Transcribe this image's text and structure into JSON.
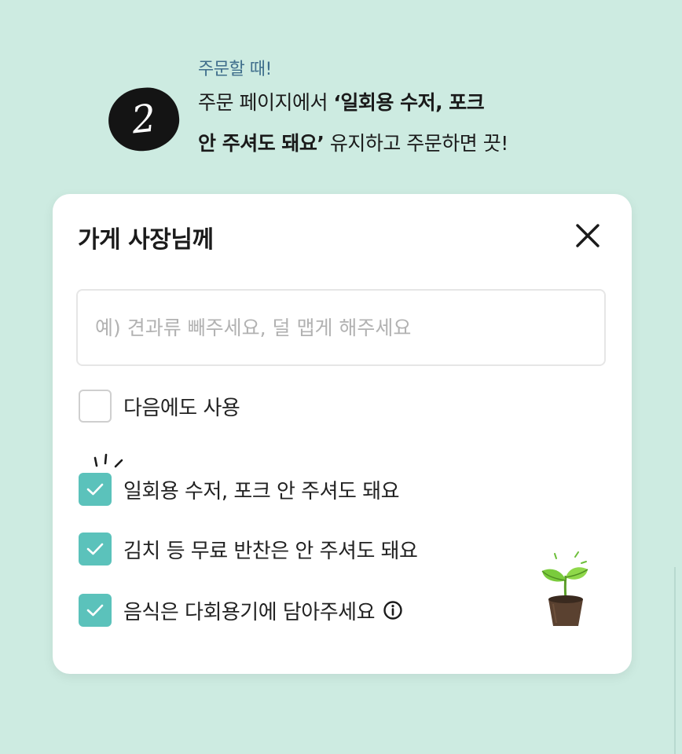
{
  "step": {
    "number": "2",
    "subtitle": "주문할 때!",
    "line1_normal": "주문 페이지에서 ",
    "line1_bold": "‘일회용 수저, 포크",
    "line2_bold": "안 주셔도 돼요’",
    "line2_normal": " 유지하고 주문하면 끗!"
  },
  "modal": {
    "title": "가게 사장님께",
    "close_icon": "close-icon",
    "input": {
      "value": "",
      "placeholder": "예) 견과류 빼주세요, 덜 맵게 해주세요"
    },
    "reuse_option": {
      "label": "다음에도 사용",
      "checked": false
    },
    "options": [
      {
        "label": "일회용 수저, 포크 안 주셔도 돼요",
        "checked": true
      },
      {
        "label": "김치 등 무료 반찬은 안 주셔도 돼요",
        "checked": true
      },
      {
        "label": "음식은 다회용기에 담아주세요",
        "checked": true,
        "icon": "info-icon"
      }
    ]
  },
  "colors": {
    "background": "#cdebe1",
    "accent_check": "#5bc2bb",
    "subtitle": "#3f6e8c"
  }
}
